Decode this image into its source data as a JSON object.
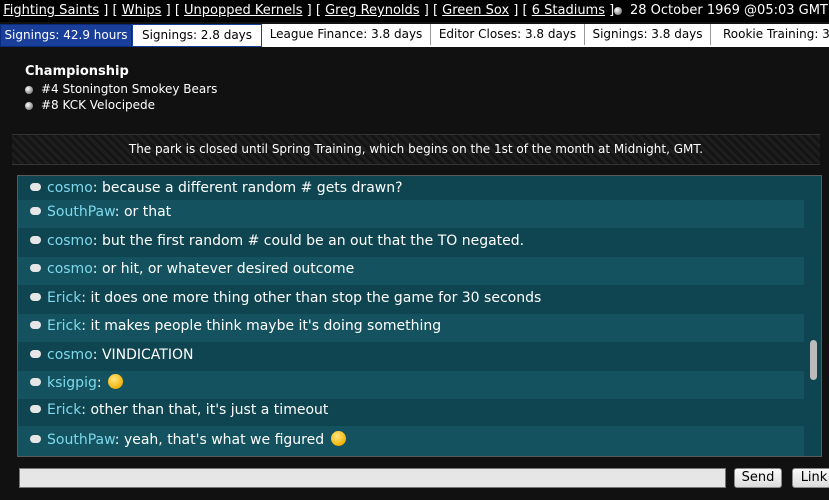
{
  "top_nav": {
    "links": [
      "Fighting Saints",
      "Whips",
      "Unpopped Kernels",
      "Greg Reynolds",
      "Green Sox",
      "6 Stadiums"
    ],
    "clock": "28 October 1969 @05:03 GMT"
  },
  "tabs": [
    {
      "label": "Signings: 42.9 hours",
      "active": true
    },
    {
      "label": "Signings: 2.8 days",
      "active": false
    },
    {
      "label": "League Finance: 3.8 days",
      "active": false
    },
    {
      "label": "Editor Closes: 3.8 days",
      "active": false
    },
    {
      "label": "Signings: 3.8 days",
      "active": false
    },
    {
      "label": "Rookie Training: 3.",
      "active": false
    }
  ],
  "championship": {
    "title": "Championship",
    "teams": [
      "#4 Stonington Smokey Bears",
      "#8 KCK Velocipede"
    ]
  },
  "notice": "The park is closed until Spring Training, which begins on the 1st of the month at Midnight, GMT.",
  "chat": [
    {
      "user": "cosmo",
      "text": "because a different random # gets drawn?"
    },
    {
      "user": "SouthPaw",
      "text": "or that"
    },
    {
      "user": "cosmo",
      "text": "but the first random # could be an out that the TO negated."
    },
    {
      "user": "cosmo",
      "text": "or hit, or whatever desired outcome"
    },
    {
      "user": "Erick",
      "text": "it does one more thing other than stop the game for 30 seconds"
    },
    {
      "user": "Erick",
      "text": "it makes people think maybe it's doing something"
    },
    {
      "user": "cosmo",
      "text": "VINDICATION"
    },
    {
      "user": "ksigpig",
      "text": "",
      "emoji": "laughing-emoji"
    },
    {
      "user": "Erick",
      "text": "other than that, it's just a timeout"
    },
    {
      "user": "SouthPaw",
      "text": "yeah, that's what we figured",
      "emoji": "tongue-emoji"
    }
  ],
  "controls": {
    "send_label": "Send",
    "link_label": "Link"
  },
  "colors": {
    "tab_active": "#1a3f9a",
    "chat_bg": "#0f4550",
    "username": "#7fd8ec"
  }
}
